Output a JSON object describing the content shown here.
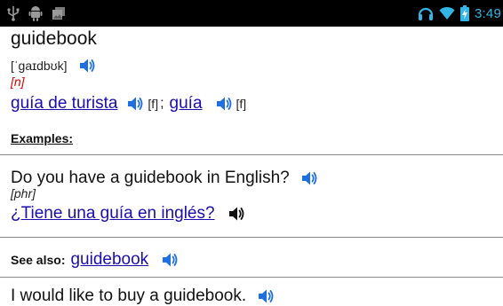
{
  "status_bar": {
    "icons_left": [
      "usb-icon",
      "android-debug-icon",
      "gallery-icon"
    ],
    "icons_right": [
      "headset-icon",
      "wifi-icon",
      "battery-charging-icon"
    ],
    "time": "3:49",
    "time_color": "#33b5e5"
  },
  "entry": {
    "headword": "guidebook",
    "pronunciation": "[ˈɡaɪdbʊk]",
    "part_of_speech": "[n]",
    "translations": [
      {
        "text": "guía de turista",
        "gender": "[f]"
      },
      {
        "text": "guía",
        "gender": "[f]"
      }
    ],
    "separator": ";"
  },
  "examples": {
    "label": "Examples:",
    "items": [
      {
        "text": "Do you have a guidebook in English?",
        "part_of_speech": "[phr]",
        "translation": "¿Tiene una guía en inglés?"
      }
    ]
  },
  "see_also": {
    "label": "See also:",
    "link": "guidebook"
  },
  "next_example": {
    "text": "I would like to buy a guidebook."
  },
  "colors": {
    "link": "#1a0dab",
    "speaker_blue": "#1e6fe0",
    "speaker_black": "#111111",
    "pos_red": "#dd0000",
    "status_bar_bg": "#000000"
  }
}
